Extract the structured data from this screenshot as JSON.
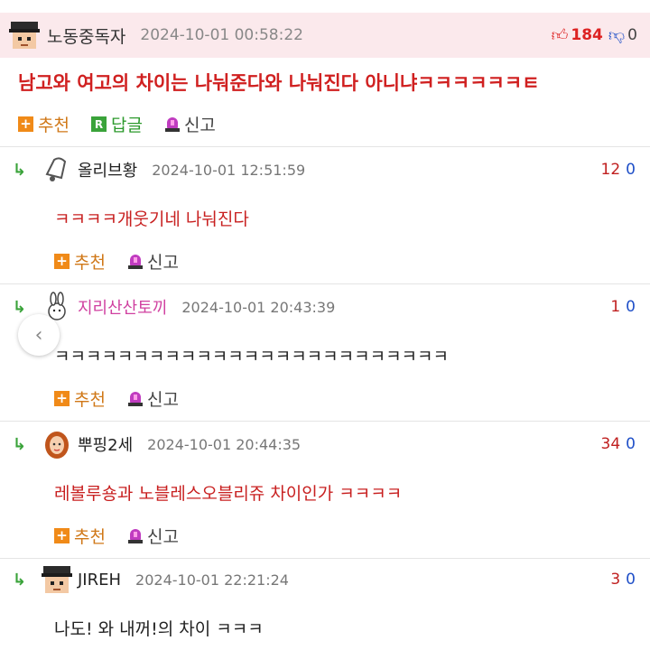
{
  "post": {
    "nickname": "노동중독자",
    "date": "2024-10-01 00:58:22",
    "up_count": "184",
    "down_count": "0",
    "title": "남고와 여고의 차이는 나눠준다와 나눠진다 아니냐ㅋㅋㅋㅋㅋㅋㅌ",
    "actions": {
      "recommend": "추천",
      "reply": "답글",
      "report": "신고"
    }
  },
  "comments": [
    {
      "nickname": "올리브황",
      "date": "2024-10-01 12:51:59",
      "up": "12",
      "down": "0",
      "text": "ㅋㅋㅋㅋ개웃기네 나눠진다",
      "recommend": "추천",
      "report": "신고"
    },
    {
      "nickname": "지리산산토끼",
      "date": "2024-10-01 20:43:39",
      "up": "1",
      "down": "0",
      "text": "ㅋㅋㅋㅋㅋㅋㅋㅋㅋㅋㅋㅋㅋㅋㅋㅋㅋㅋㅋㅋㅋㅋㅋㅋㅋ",
      "recommend": "추천",
      "report": "신고"
    },
    {
      "nickname": "뿌핑2세",
      "date": "2024-10-01 20:44:35",
      "up": "34",
      "down": "0",
      "text": "레볼루숑과 노블레스오블리쥬 차이인가 ㅋㅋㅋㅋ",
      "recommend": "추천",
      "report": "신고"
    },
    {
      "nickname": "JIREH",
      "date": "2024-10-01 22:21:24",
      "up": "3",
      "down": "0",
      "text": "나도! 와 내꺼!의 차이 ㅋㅋㅋ"
    }
  ],
  "colors": {
    "title": "#d02020",
    "header_bg": "#fbe9ec",
    "recommend": "#f08a18",
    "reply": "#3aa33a",
    "nick_pink": "#d040a0"
  }
}
